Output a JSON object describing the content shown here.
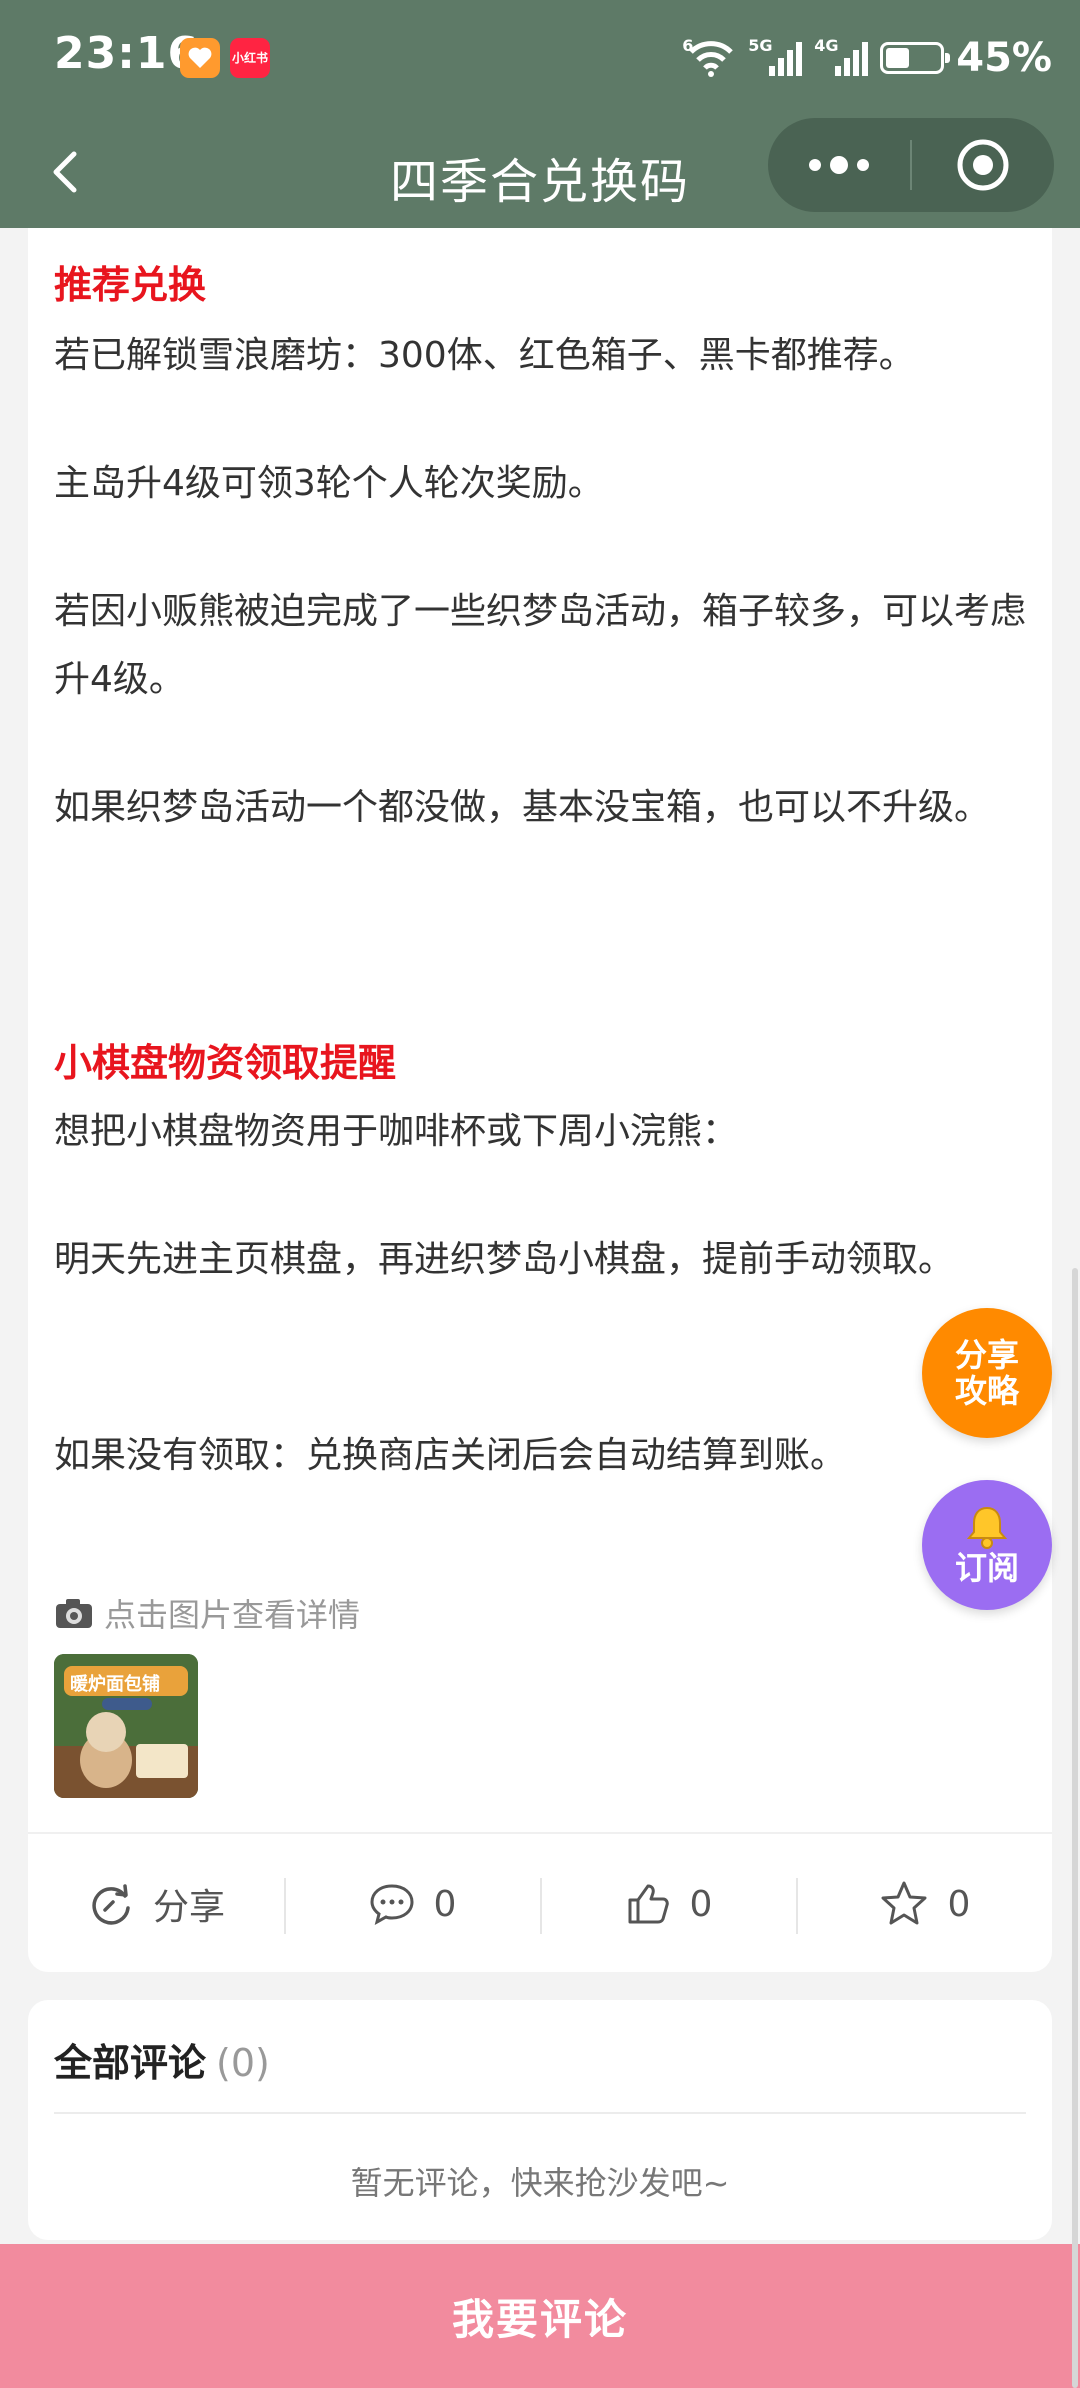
{
  "status_bar": {
    "time": "23:16",
    "app_badge_label": "小红书",
    "signal_5g": "5G",
    "signal_4g": "4G",
    "wifi_tag": "6",
    "battery_level": 0.45,
    "battery_text": "45%"
  },
  "nav": {
    "title": "四季合兑换码"
  },
  "article": {
    "section1_title": "推荐兑换",
    "p1": "若已解锁雪浪磨坊：300体、红色箱子、黑卡都推荐。",
    "p2": "主岛升4级可领3轮个人轮次奖励。",
    "p3": "若因小贩熊被迫完成了一些织梦岛活动，箱子较多，可以考虑升4级。",
    "p4": "如果织梦岛活动一个都没做，基本没宝箱，也可以不升级。",
    "section2_title": "小棋盘物资领取提醒",
    "p5": "想把小棋盘物资用于咖啡杯或下周小浣熊：",
    "p6": "明天先进主页棋盘，再进织梦岛小棋盘，提前手动领取。",
    "p7": "如果没有领取：兑换商店关闭后会自动结算到账。",
    "image_hint": "点击图片查看详情",
    "thumb_title": "暖炉面包铺"
  },
  "actions": {
    "share_label": "分享",
    "comment_count": "0",
    "like_count": "0",
    "favorite_count": "0"
  },
  "comments": {
    "title": "全部评论",
    "count": "(0)",
    "empty_text": "暂无评论，快来抢沙发吧~"
  },
  "bottom_button": "我要评论",
  "fab": {
    "share_line1": "分享",
    "share_line2": "攻略",
    "subscribe_label": "订阅"
  },
  "colors": {
    "header_green": "#5e7a67",
    "accent_red": "#e8151e",
    "bottom_pink": "#f28b9e",
    "fab_orange": "#ff8a00",
    "fab_purple": "#9b6df2"
  }
}
